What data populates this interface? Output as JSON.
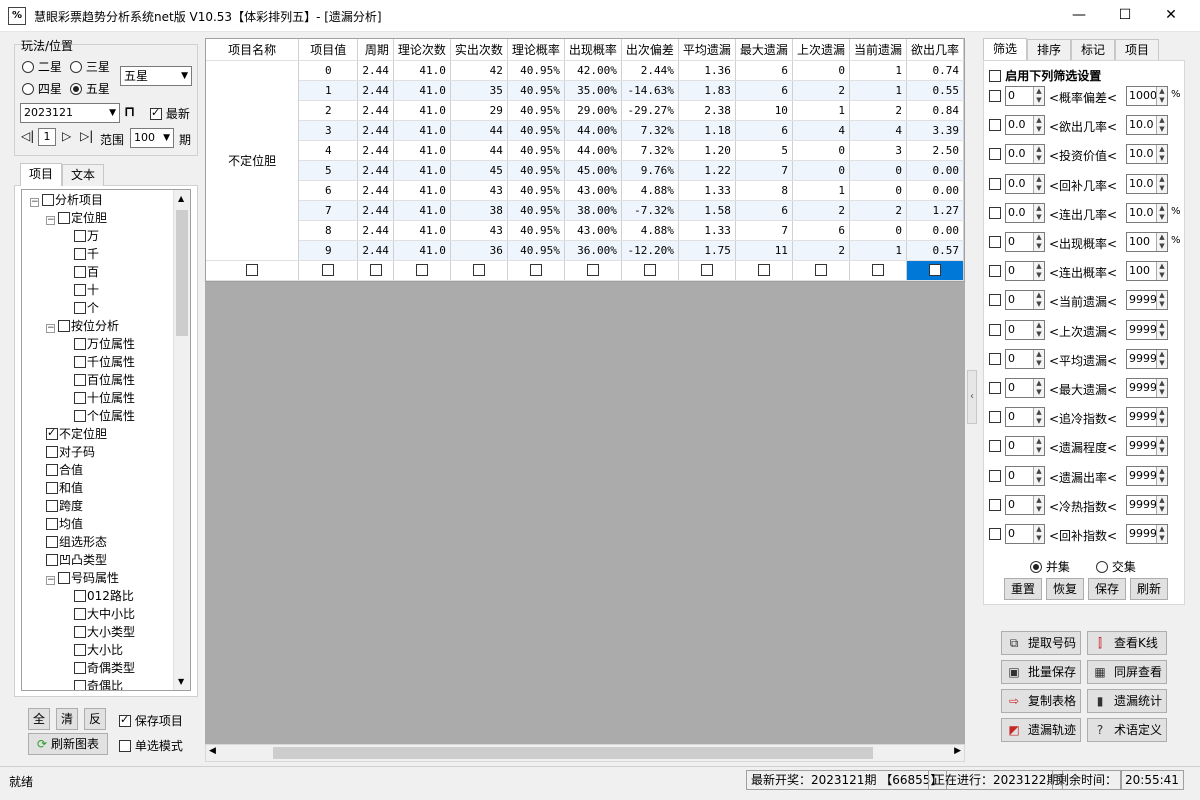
{
  "window": {
    "icon": "%",
    "title": "慧眼彩票趋势分析系统net版 V10.53【体彩排列五】- [遗漏分析]",
    "minimize": "—",
    "maximize": "☐",
    "close": "✕"
  },
  "left": {
    "play_group_label": "玩法/位置",
    "radios": [
      {
        "label": "二星",
        "selected": false
      },
      {
        "label": "三星",
        "selected": false
      },
      {
        "label": "四星",
        "selected": false
      },
      {
        "label": "五星",
        "selected": true
      }
    ],
    "position_select": "五星",
    "period_select": "2023121",
    "latest_label": "最新",
    "latest_checked": true,
    "step_value": "1",
    "range_label": "范围",
    "range_value": "100",
    "range_unit": "期",
    "tabs": [
      "项目",
      "文本"
    ],
    "tree": [
      {
        "label": "分析项目",
        "level": 0,
        "toggle": "−",
        "checked": false
      },
      {
        "label": "定位胆",
        "level": 1,
        "toggle": "−",
        "checked": false
      },
      {
        "label": "万",
        "level": 2,
        "toggle": "",
        "checked": false
      },
      {
        "label": "千",
        "level": 2,
        "toggle": "",
        "checked": false
      },
      {
        "label": "百",
        "level": 2,
        "toggle": "",
        "checked": false
      },
      {
        "label": "十",
        "level": 2,
        "toggle": "",
        "checked": false
      },
      {
        "label": "个",
        "level": 2,
        "toggle": "",
        "checked": false
      },
      {
        "label": "按位分析",
        "level": 1,
        "toggle": "−",
        "checked": false
      },
      {
        "label": "万位属性",
        "level": 2,
        "toggle": "",
        "checked": false
      },
      {
        "label": "千位属性",
        "level": 2,
        "toggle": "",
        "checked": false
      },
      {
        "label": "百位属性",
        "level": 2,
        "toggle": "",
        "checked": false
      },
      {
        "label": "十位属性",
        "level": 2,
        "toggle": "",
        "checked": false
      },
      {
        "label": "个位属性",
        "level": 2,
        "toggle": "",
        "checked": false
      },
      {
        "label": "不定位胆",
        "level": 1,
        "toggle": "",
        "checked": true
      },
      {
        "label": "对子码",
        "level": 1,
        "toggle": "",
        "checked": false
      },
      {
        "label": "合值",
        "level": 1,
        "toggle": "",
        "checked": false
      },
      {
        "label": "和值",
        "level": 1,
        "toggle": "",
        "checked": false
      },
      {
        "label": "跨度",
        "level": 1,
        "toggle": "",
        "checked": false
      },
      {
        "label": "均值",
        "level": 1,
        "toggle": "",
        "checked": false
      },
      {
        "label": "组选形态",
        "level": 1,
        "toggle": "",
        "checked": false
      },
      {
        "label": "凹凸类型",
        "level": 1,
        "toggle": "",
        "checked": false
      },
      {
        "label": "号码属性",
        "level": 1,
        "toggle": "−",
        "checked": false
      },
      {
        "label": "012路比",
        "level": 2,
        "toggle": "",
        "checked": false
      },
      {
        "label": "大中小比",
        "level": 2,
        "toggle": "",
        "checked": false
      },
      {
        "label": "大小类型",
        "level": 2,
        "toggle": "",
        "checked": false
      },
      {
        "label": "大小比",
        "level": 2,
        "toggle": "",
        "checked": false
      },
      {
        "label": "奇偶类型",
        "level": 2,
        "toggle": "",
        "checked": false
      },
      {
        "label": "奇偶比",
        "level": 2,
        "toggle": "",
        "checked": false
      }
    ],
    "btn_all": "全",
    "btn_clear": "清",
    "btn_invert": "反",
    "save_items_label": "保存项目",
    "save_items_checked": true,
    "refresh_chart": "刷新图表",
    "single_mode_label": "单选模式",
    "single_mode_checked": false
  },
  "table": {
    "headers": [
      "项目名称",
      "项目值",
      "周期",
      "理论次数",
      "实出次数",
      "理论概率",
      "出现概率",
      "出次偏差",
      "平均遗漏",
      "最大遗漏",
      "上次遗漏",
      "当前遗漏",
      "欲出几率"
    ],
    "group_name": "不定位胆",
    "rows": [
      {
        "val": "0",
        "period": "2.44",
        "theory": "41.0",
        "actual": "42",
        "tprob": "40.95%",
        "aprob": "42.00%",
        "dev": "2.44%",
        "avg": "1.36",
        "max": "6",
        "last": "0",
        "cur": "1",
        "chance": "0.74"
      },
      {
        "val": "1",
        "period": "2.44",
        "theory": "41.0",
        "actual": "35",
        "tprob": "40.95%",
        "aprob": "35.00%",
        "dev": "-14.63%",
        "avg": "1.83",
        "max": "6",
        "last": "2",
        "cur": "1",
        "chance": "0.55"
      },
      {
        "val": "2",
        "period": "2.44",
        "theory": "41.0",
        "actual": "29",
        "tprob": "40.95%",
        "aprob": "29.00%",
        "dev": "-29.27%",
        "avg": "2.38",
        "max": "10",
        "last": "1",
        "cur": "2",
        "chance": "0.84"
      },
      {
        "val": "3",
        "period": "2.44",
        "theory": "41.0",
        "actual": "44",
        "tprob": "40.95%",
        "aprob": "44.00%",
        "dev": "7.32%",
        "avg": "1.18",
        "max": "6",
        "last": "4",
        "cur": "4",
        "chance": "3.39"
      },
      {
        "val": "4",
        "period": "2.44",
        "theory": "41.0",
        "actual": "44",
        "tprob": "40.95%",
        "aprob": "44.00%",
        "dev": "7.32%",
        "avg": "1.20",
        "max": "5",
        "last": "0",
        "cur": "3",
        "chance": "2.50"
      },
      {
        "val": "5",
        "period": "2.44",
        "theory": "41.0",
        "actual": "45",
        "tprob": "40.95%",
        "aprob": "45.00%",
        "dev": "9.76%",
        "avg": "1.22",
        "max": "7",
        "last": "0",
        "cur": "0",
        "chance": "0.00"
      },
      {
        "val": "6",
        "period": "2.44",
        "theory": "41.0",
        "actual": "43",
        "tprob": "40.95%",
        "aprob": "43.00%",
        "dev": "4.88%",
        "avg": "1.33",
        "max": "8",
        "last": "1",
        "cur": "0",
        "chance": "0.00"
      },
      {
        "val": "7",
        "period": "2.44",
        "theory": "41.0",
        "actual": "38",
        "tprob": "40.95%",
        "aprob": "38.00%",
        "dev": "-7.32%",
        "avg": "1.58",
        "max": "6",
        "last": "2",
        "cur": "2",
        "chance": "1.27"
      },
      {
        "val": "8",
        "period": "2.44",
        "theory": "41.0",
        "actual": "43",
        "tprob": "40.95%",
        "aprob": "43.00%",
        "dev": "4.88%",
        "avg": "1.33",
        "max": "7",
        "last": "6",
        "cur": "0",
        "chance": "0.00"
      },
      {
        "val": "9",
        "period": "2.44",
        "theory": "41.0",
        "actual": "36",
        "tprob": "40.95%",
        "aprob": "36.00%",
        "dev": "-12.20%",
        "avg": "1.75",
        "max": "11",
        "last": "2",
        "cur": "1",
        "chance": "0.57"
      }
    ]
  },
  "right": {
    "tabs": [
      "筛选",
      "排序",
      "标记",
      "项目"
    ],
    "enable_label": "启用下列筛选设置",
    "filters": [
      {
        "min": "0",
        "label": "<概率偏差<",
        "max": "1000",
        "unit": "%"
      },
      {
        "min": "0.0",
        "label": "<欲出几率<",
        "max": "10.0",
        "unit": ""
      },
      {
        "min": "0.0",
        "label": "<投资价值<",
        "max": "10.0",
        "unit": ""
      },
      {
        "min": "0.0",
        "label": "<回补几率<",
        "max": "10.0",
        "unit": ""
      },
      {
        "min": "0.0",
        "label": "<连出几率<",
        "max": "10.0",
        "unit": "%"
      },
      {
        "min": "0",
        "label": "<出现概率<",
        "max": "100",
        "unit": "%"
      },
      {
        "min": "0",
        "label": "<连出概率<",
        "max": "100",
        "unit": ""
      },
      {
        "min": "0",
        "label": "<当前遗漏<",
        "max": "9999",
        "unit": ""
      },
      {
        "min": "0",
        "label": "<上次遗漏<",
        "max": "9999",
        "unit": ""
      },
      {
        "min": "0",
        "label": "<平均遗漏<",
        "max": "9999",
        "unit": ""
      },
      {
        "min": "0",
        "label": "<最大遗漏<",
        "max": "9999",
        "unit": ""
      },
      {
        "min": "0",
        "label": "<追冷指数<",
        "max": "9999",
        "unit": ""
      },
      {
        "min": "0",
        "label": "<遗漏程度<",
        "max": "9999",
        "unit": ""
      },
      {
        "min": "0",
        "label": "<遗漏出率<",
        "max": "9999",
        "unit": ""
      },
      {
        "min": "0",
        "label": "<冷热指数<",
        "max": "9999",
        "unit": ""
      },
      {
        "min": "0",
        "label": "<回补指数<",
        "max": "9999",
        "unit": ""
      }
    ],
    "union_label": "并集",
    "intersect_label": "交集",
    "btn_reset": "重置",
    "btn_restore": "恢复",
    "btn_save": "保存",
    "btn_refresh": "刷新",
    "actions": [
      {
        "label": "提取号码",
        "icon": "copy-icon",
        "glyph": "⧉"
      },
      {
        "label": "查看K线",
        "icon": "candlestick-icon",
        "glyph": "⫿"
      },
      {
        "label": "批量保存",
        "icon": "batch-save-icon",
        "glyph": "▣"
      },
      {
        "label": "同屏查看",
        "icon": "grid-icon",
        "glyph": "▦"
      },
      {
        "label": "复制表格",
        "icon": "copy-table-icon",
        "glyph": "⇨"
      },
      {
        "label": "遗漏统计",
        "icon": "bar-chart-icon",
        "glyph": "▮"
      },
      {
        "label": "遗漏轨迹",
        "icon": "trend-icon",
        "glyph": "◩"
      },
      {
        "label": "术语定义",
        "icon": "help-icon",
        "glyph": "?"
      }
    ]
  },
  "status": {
    "ready": "就绪",
    "latest": "最新开奖：2023121期 【66855】",
    "running": "正在进行：2023122期",
    "remaining_label": "剩余时间：",
    "clock": "20:55:41"
  }
}
